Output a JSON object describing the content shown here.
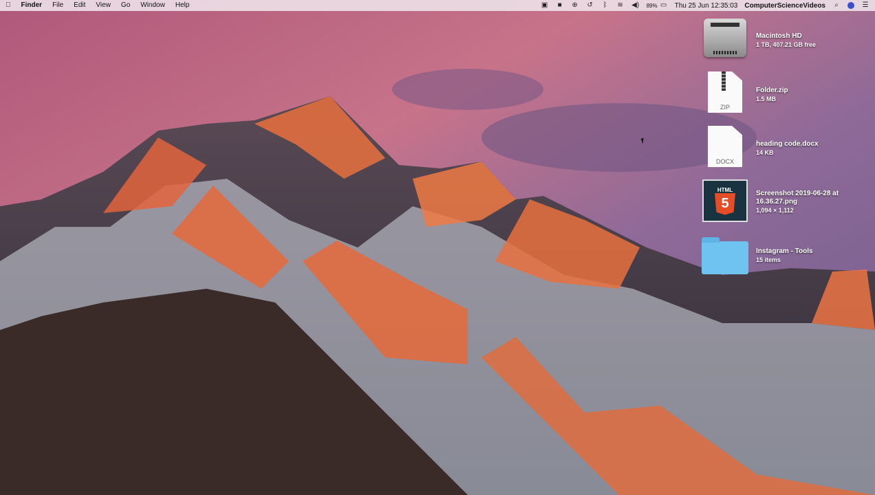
{
  "menubar": {
    "apple_icon": "apple-icon",
    "app_name": "Finder",
    "menus": [
      "File",
      "Edit",
      "View",
      "Go",
      "Window",
      "Help"
    ],
    "battery_percent": "89%",
    "datetime": "Thu 25 Jun  12:35:03",
    "user": "ComputerScienceVideos"
  },
  "desktop": {
    "items": [
      {
        "name": "Macintosh HD",
        "detail": "1 TB, 407.21 GB free"
      },
      {
        "name": "Folder.zip",
        "detail": "1.5 MB",
        "badge": "ZIP"
      },
      {
        "name": "heading code.docx",
        "detail": "14 KB",
        "badge": "DOCX"
      },
      {
        "name": "Screenshot 2019-06-28 at",
        "name2": "16.36.27.png",
        "detail": "1,094 × 1,112",
        "thumb_title": "HTML",
        "thumb_glyph": "5"
      },
      {
        "name": "Instagram - Tools",
        "detail": "15 items"
      }
    ]
  }
}
